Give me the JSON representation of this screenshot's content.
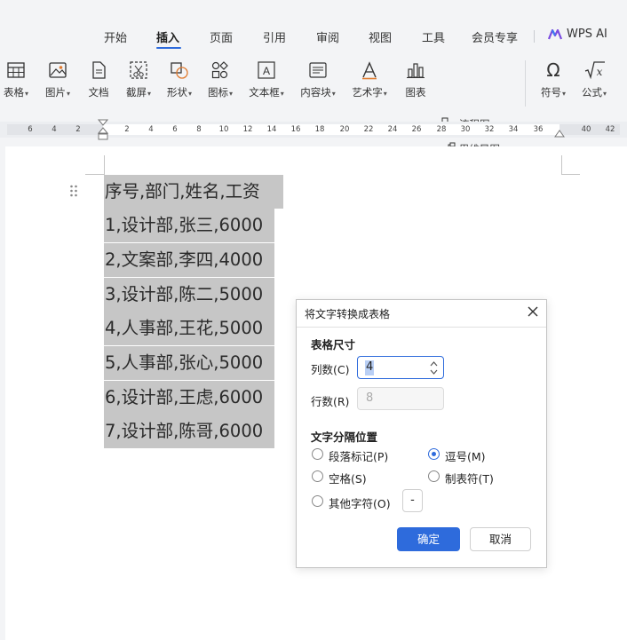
{
  "menu_tabs": [
    "开始",
    "插入",
    "页面",
    "引用",
    "审阅",
    "视图",
    "工具",
    "会员专享"
  ],
  "active_tab": "插入",
  "wps_ai_label": "WPS AI",
  "ribbon": {
    "table": "表格",
    "picture": "图片",
    "document": "文档",
    "screenshot": "截屏",
    "shape": "形状",
    "icon": "图标",
    "textbox": "文本框",
    "content_block": "内容块",
    "wordart": "艺术字",
    "chart": "图表",
    "flowchart": "流程图",
    "mindmap": "思维导图",
    "symbol": "符号",
    "formula": "公式"
  },
  "ruler_labels": [
    "6",
    "4",
    "2",
    "2",
    "4",
    "6",
    "8",
    "10",
    "12",
    "14",
    "16",
    "18",
    "20",
    "22",
    "24",
    "26",
    "28",
    "30",
    "32",
    "34",
    "36",
    "40",
    "42"
  ],
  "document": {
    "lines": [
      "序号,部门,姓名,工资",
      "1,设计部,张三,6000",
      "2,文案部,李四,4000",
      "3,设计部,陈二,5000",
      "4,人事部,王花,5000",
      "5,人事部,张心,5000",
      "6,设计部,王虑,6000",
      "7,设计部,陈哥,6000"
    ]
  },
  "dialog": {
    "title": "将文字转换成表格",
    "size_section": "表格尺寸",
    "columns_label": "列数(C)",
    "columns_value": "4",
    "rows_label": "行数(R)",
    "rows_value": "8",
    "separator_section": "文字分隔位置",
    "options": {
      "paragraph": "段落标记(P)",
      "comma": "逗号(M)",
      "space": "空格(S)",
      "tab": "制表符(T)",
      "other": "其他字符(O)"
    },
    "selected_option": "comma",
    "other_char_value": "-",
    "ok_label": "确定",
    "cancel_label": "取消"
  },
  "colors": {
    "accent": "#2e6bdc",
    "selection": "#c6c6c6"
  }
}
